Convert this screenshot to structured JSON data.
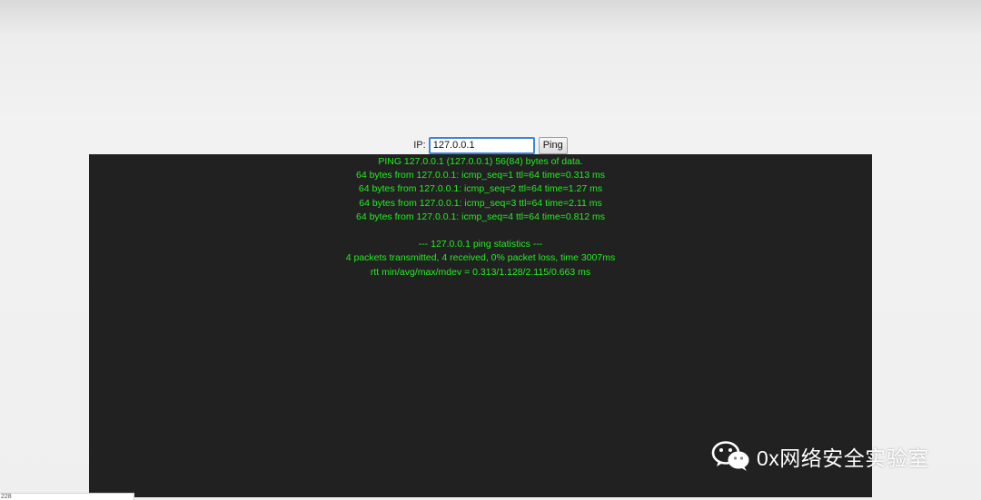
{
  "form": {
    "ip_label": "IP:",
    "ip_value": "127.0.0.1",
    "ping_button_label": "Ping"
  },
  "output": {
    "lines": [
      "PING 127.0.0.1 (127.0.0.1) 56(84) bytes of data.",
      "64 bytes from 127.0.0.1: icmp_seq=1 ttl=64 time=0.313 ms",
      "64 bytes from 127.0.0.1: icmp_seq=2 ttl=64 time=1.27 ms",
      "64 bytes from 127.0.0.1: icmp_seq=3 ttl=64 time=2.11 ms",
      "64 bytes from 127.0.0.1: icmp_seq=4 ttl=64 time=0.812 ms",
      "",
      "--- 127.0.0.1 ping statistics ---",
      "4 packets transmitted, 4 received, 0% packet loss, time 3007ms",
      "rtt min/avg/max/mdev = 0.313/1.128/2.115/0.663 ms"
    ]
  },
  "status_bar": {
    "text": "228"
  },
  "watermark": {
    "icon": "wechat-icon",
    "text": "0x网络安全实验室"
  },
  "colors": {
    "terminal_bg": "#212121",
    "terminal_text": "#22ee22",
    "input_focus_border": "#3b86d9"
  }
}
